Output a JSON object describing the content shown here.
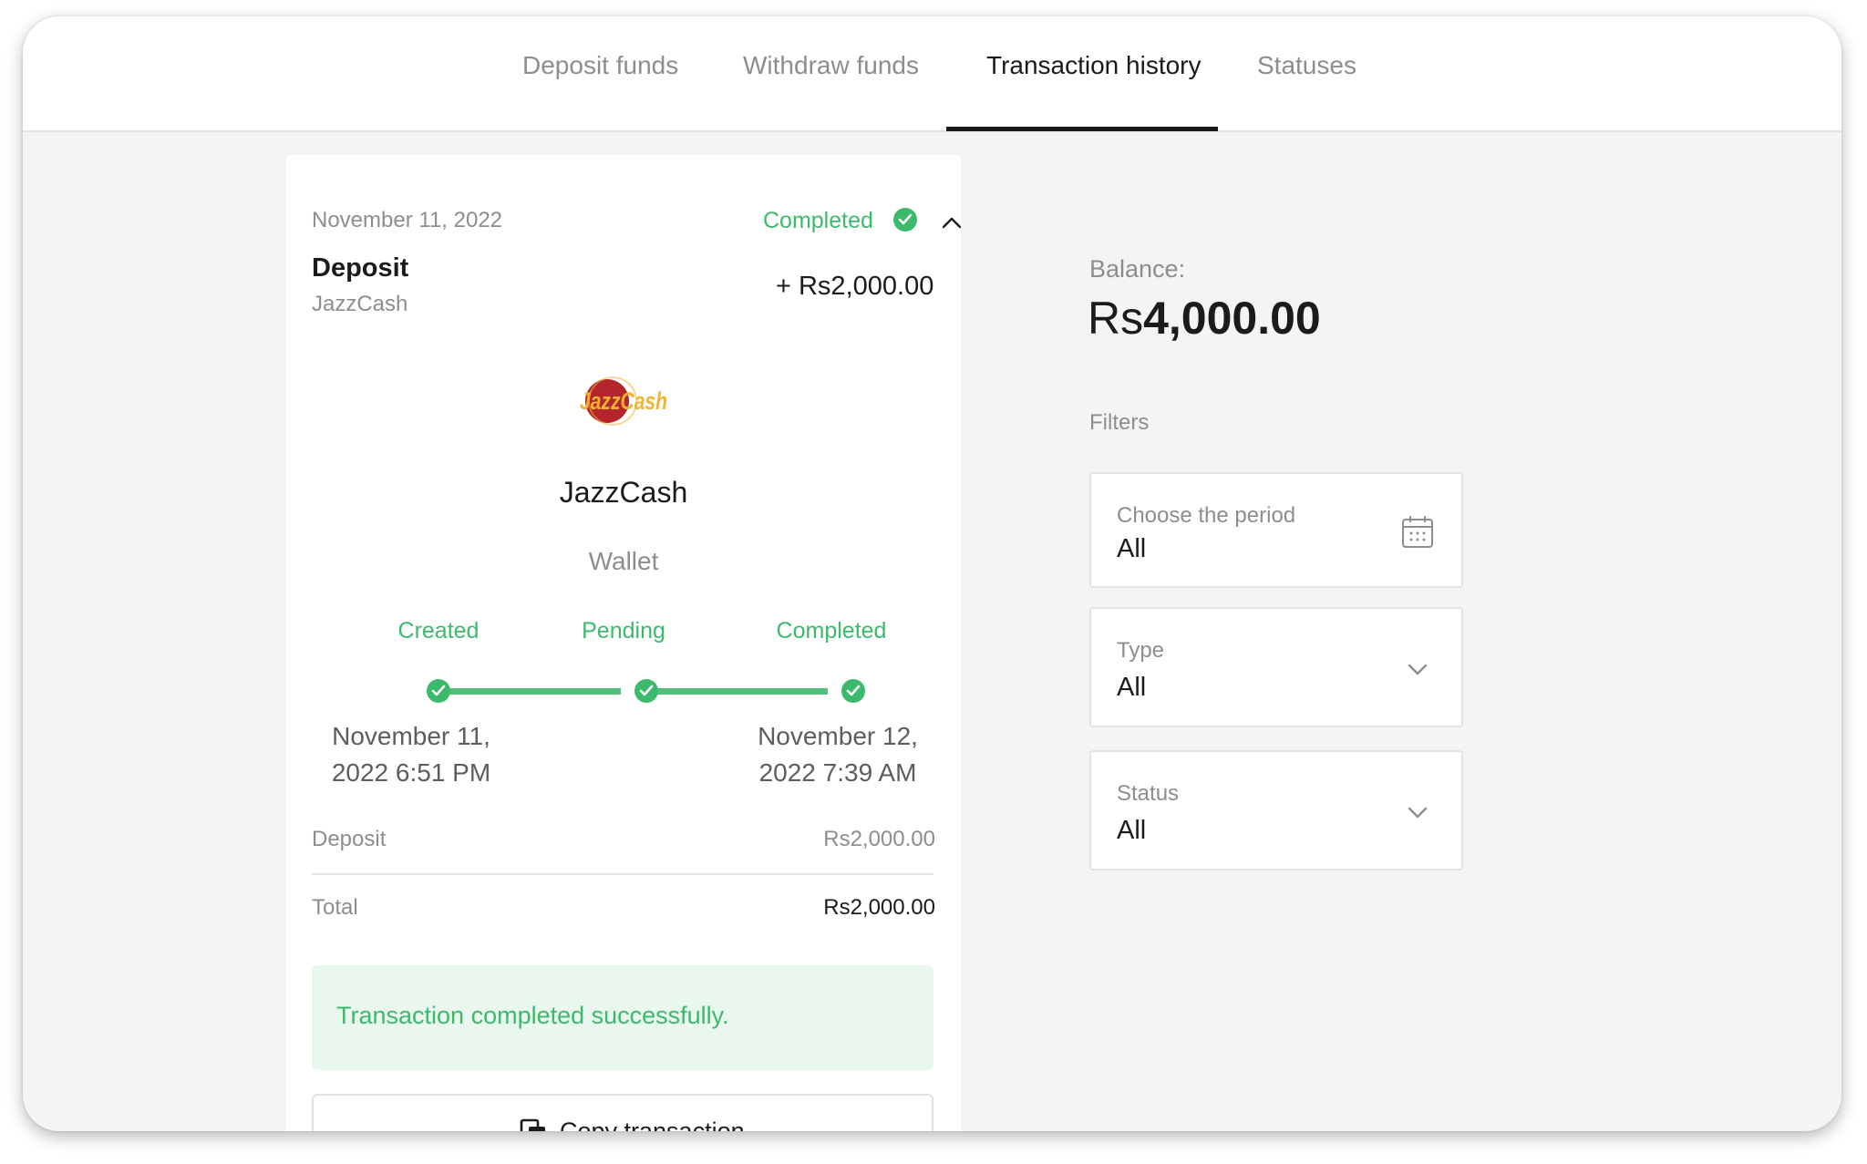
{
  "tabs": [
    {
      "label": "Deposit funds",
      "active": false
    },
    {
      "label": "Withdraw funds",
      "active": false
    },
    {
      "label": "Transaction history",
      "active": true
    },
    {
      "label": "Statuses",
      "active": false
    }
  ],
  "transaction": {
    "date": "November 11, 2022",
    "status": "Completed",
    "type": "Deposit",
    "method": "JazzCash",
    "amount": "+ Rs2,000.00",
    "provider_name": "JazzCash",
    "provider_logo_text": "JazzCash",
    "provider_category": "Wallet",
    "steps": [
      {
        "label": "Created",
        "date_line1": "November 11,",
        "date_line2": "2022 6:51 PM"
      },
      {
        "label": "Pending",
        "date_line1": "",
        "date_line2": ""
      },
      {
        "label": "Completed",
        "date_line1": "November 12,",
        "date_line2": "2022 7:39 AM"
      }
    ],
    "summary": {
      "deposit_label": "Deposit",
      "deposit_value": "Rs2,000.00",
      "total_label": "Total",
      "total_value": "Rs2,000.00"
    },
    "success_message": "Transaction completed successfully.",
    "copy_button": "Copy transaction"
  },
  "balance": {
    "label": "Balance:",
    "currency": "Rs",
    "value": "4,000.00"
  },
  "filters": {
    "title": "Filters",
    "period": {
      "label": "Choose the period",
      "value": "All"
    },
    "type": {
      "label": "Type",
      "value": "All"
    },
    "status": {
      "label": "Status",
      "value": "All"
    }
  },
  "colors": {
    "accent_green": "#3cba6c",
    "progress_green": "#52c07a",
    "success_bg": "#eaf7ef",
    "text_dark": "#1b1b1b",
    "text_muted": "#8a8f8d",
    "logo_red": "#b3262d",
    "logo_yellow": "#f2b233"
  }
}
